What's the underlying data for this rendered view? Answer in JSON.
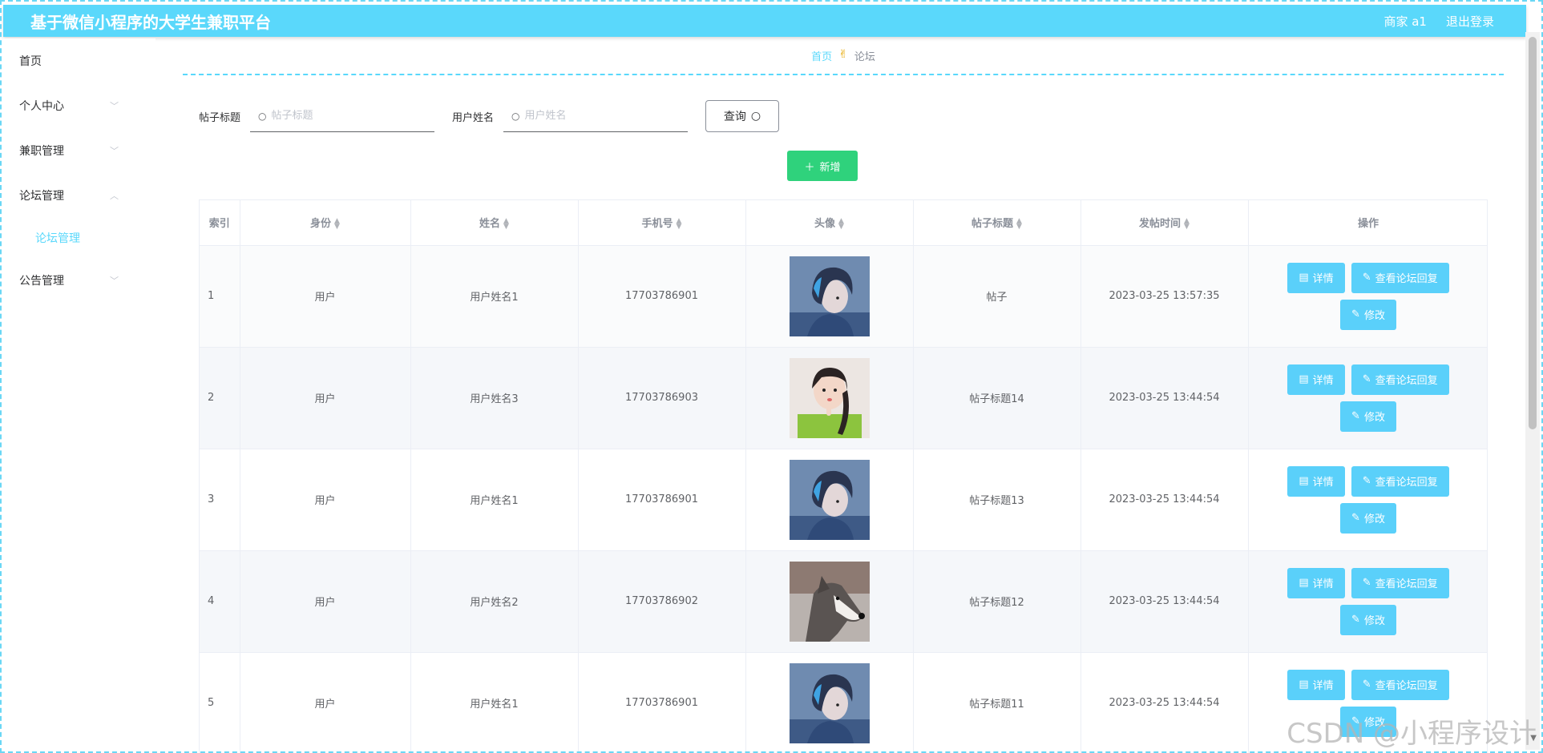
{
  "header": {
    "title": "基于微信小程序的大学生兼职平台",
    "user": "商家 a1",
    "logout": "退出登录"
  },
  "sidebar": {
    "items": [
      {
        "label": "首页"
      },
      {
        "label": "个人中心"
      },
      {
        "label": "兼职管理"
      },
      {
        "label": "论坛管理"
      },
      {
        "label": "论坛管理"
      },
      {
        "label": "公告管理"
      }
    ]
  },
  "breadcrumb": {
    "home": "首页",
    "current": "论坛"
  },
  "search": {
    "title_label": "帖子标题",
    "title_placeholder": "帖子标题",
    "name_label": "用户姓名",
    "name_placeholder": "用户姓名",
    "query_label": "查询"
  },
  "toolbar": {
    "add_label": "新增"
  },
  "table": {
    "columns": [
      "索引",
      "身份",
      "姓名",
      "手机号",
      "头像",
      "帖子标题",
      "发帖时间",
      "操作"
    ],
    "rows": [
      {
        "index": "1",
        "role": "用户",
        "name": "用户姓名1",
        "phone": "17703786901",
        "avatar": "anime-boy",
        "title": "帖子",
        "time": "2023-03-25 13:57:35"
      },
      {
        "index": "2",
        "role": "用户",
        "name": "用户姓名3",
        "phone": "17703786903",
        "avatar": "girl-green",
        "title": "帖子标题14",
        "time": "2023-03-25 13:44:54"
      },
      {
        "index": "3",
        "role": "用户",
        "name": "用户姓名1",
        "phone": "17703786901",
        "avatar": "anime-boy",
        "title": "帖子标题13",
        "time": "2023-03-25 13:44:54"
      },
      {
        "index": "4",
        "role": "用户",
        "name": "用户姓名2",
        "phone": "17703786902",
        "avatar": "husky-dog",
        "title": "帖子标题12",
        "time": "2023-03-25 13:44:54"
      },
      {
        "index": "5",
        "role": "用户",
        "name": "用户姓名1",
        "phone": "17703786901",
        "avatar": "anime-boy",
        "title": "帖子标题11",
        "time": "2023-03-25 13:44:54"
      }
    ],
    "actions": {
      "detail": "详情",
      "view_replies": "查看论坛回复",
      "edit": "修改"
    }
  },
  "watermark": "CSDN @小程序设计",
  "colors": {
    "accent": "#5ad8fb",
    "add_button": "#2fd27c",
    "action_button": "#5ad0fa"
  }
}
